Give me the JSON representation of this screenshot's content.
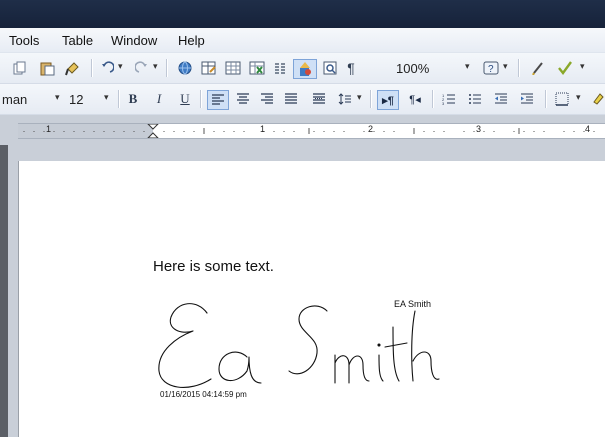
{
  "menu": [
    {
      "label": "Tools"
    },
    {
      "label": "Table"
    },
    {
      "label": "Window"
    },
    {
      "label": "Help"
    }
  ],
  "toolbar": {
    "zoom": "100%",
    "font_name": "man",
    "font_size": "12",
    "bold_label": "B",
    "italic_label": "I",
    "underline_label": "U"
  },
  "ruler": {
    "numbers": [
      "1",
      "1",
      "2",
      "3",
      "4"
    ]
  },
  "document": {
    "body_text": "Here is some text.",
    "signature_name": "EA Smith",
    "signature_timestamp": "01/16/2015 04:14:59 pm",
    "signature_ink_text": "Ea Smith"
  },
  "colors": {
    "titlebar": "#1f2e48",
    "accent": "#3b6fb5",
    "workspace": "#c9cfd8"
  }
}
